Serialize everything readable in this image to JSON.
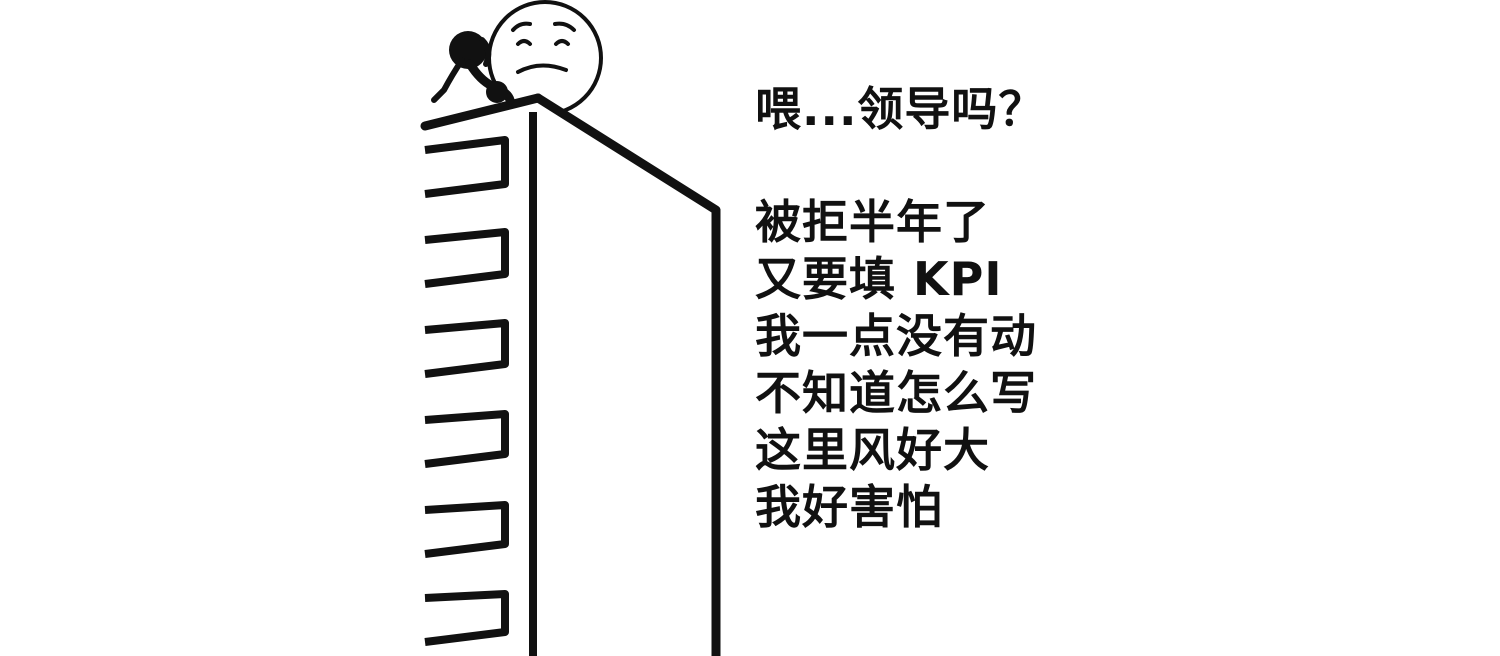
{
  "meme": {
    "caption_lines": [
      "喂...领导吗？",
      "被拒半年了",
      "又要填 KPI",
      "我一点没有动",
      "不知道怎么写",
      "这里风好大",
      "我好害怕"
    ]
  },
  "colors": {
    "ink": "#111111",
    "background": "#ffffff"
  },
  "icons": {
    "figure": "stick-figure-on-phone",
    "face": "worried-face",
    "building": "tall-building"
  }
}
